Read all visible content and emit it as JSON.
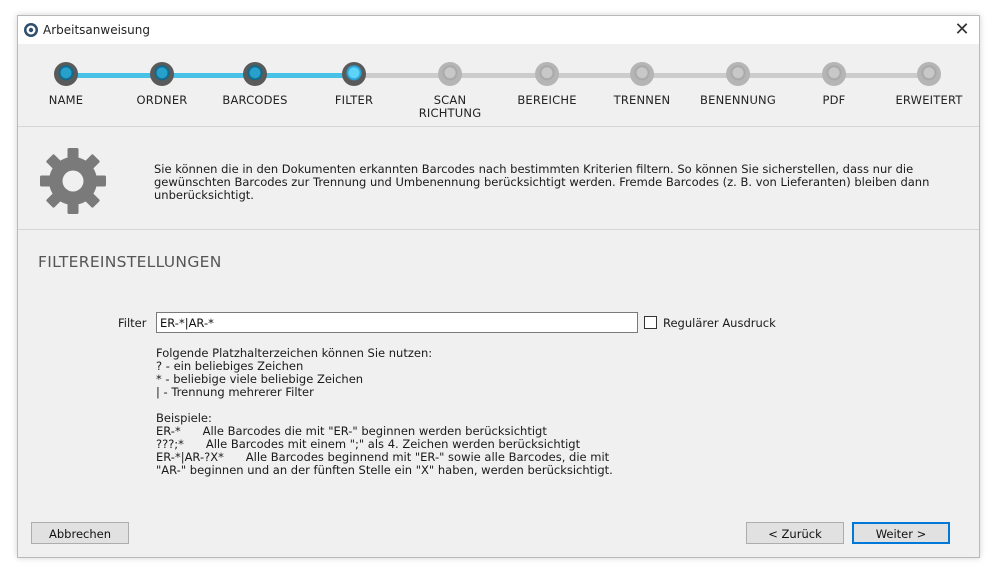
{
  "window": {
    "title": "Arbeitsanweisung",
    "close_glyph": "✕"
  },
  "steps": [
    {
      "label": "NAME",
      "state": "done"
    },
    {
      "label": "ORDNER",
      "state": "done"
    },
    {
      "label": "BARCODES",
      "state": "done"
    },
    {
      "label": "FILTER",
      "state": "current"
    },
    {
      "label": "SCAN\nRICHTUNG",
      "state": "todo"
    },
    {
      "label": "BEREICHE",
      "state": "todo"
    },
    {
      "label": "TRENNEN",
      "state": "todo"
    },
    {
      "label": "BENENNUNG",
      "state": "todo"
    },
    {
      "label": "PDF",
      "state": "todo"
    },
    {
      "label": "ERWEITERT",
      "state": "todo"
    }
  ],
  "info": {
    "icon": "gear-icon",
    "lines": [
      "Sie können die in den Dokumenten erkannten Barcodes nach bestimmten Kriterien filtern. So können Sie sicherstellen, dass nur die",
      "gewünschten Barcodes zur Trennung und Umbenennung berücksichtigt werden. Fremde Barcodes (z. B. von Lieferanten) bleiben dann",
      "unberücksichtigt."
    ]
  },
  "section": {
    "title": "FILTEREINSTELLUNGEN"
  },
  "filter": {
    "label": "Filter",
    "value": "ER-*|AR-*",
    "regex_label": "Regulärer Ausdruck",
    "regex_checked": false
  },
  "help": {
    "lines": [
      "Folgende Platzhalterzeichen können Sie nutzen:",
      "? - ein beliebiges Zeichen",
      "* - beliebige viele beliebige Zeichen",
      "| - Trennung mehrerer Filter",
      "",
      "Beispiele:",
      "ER-*      Alle Barcodes die mit \"ER-\" beginnen werden berücksichtigt",
      "???;*      Alle Barcodes mit einem \";\" als 4. Zeichen werden berücksichtigt",
      "ER-*|AR-?X*      Alle Barcodes beginnend mit \"ER-\" sowie alle Barcodes, die mit",
      "\"AR-\" beginnen und an der fünften Stelle ein \"X\" haben, werden berücksichtigt."
    ]
  },
  "buttons": {
    "cancel": "Abbrechen",
    "back": "< Zurück",
    "next": "Weiter >"
  },
  "colors": {
    "accent": "#47c1e6",
    "primary_border": "#0078d7"
  }
}
